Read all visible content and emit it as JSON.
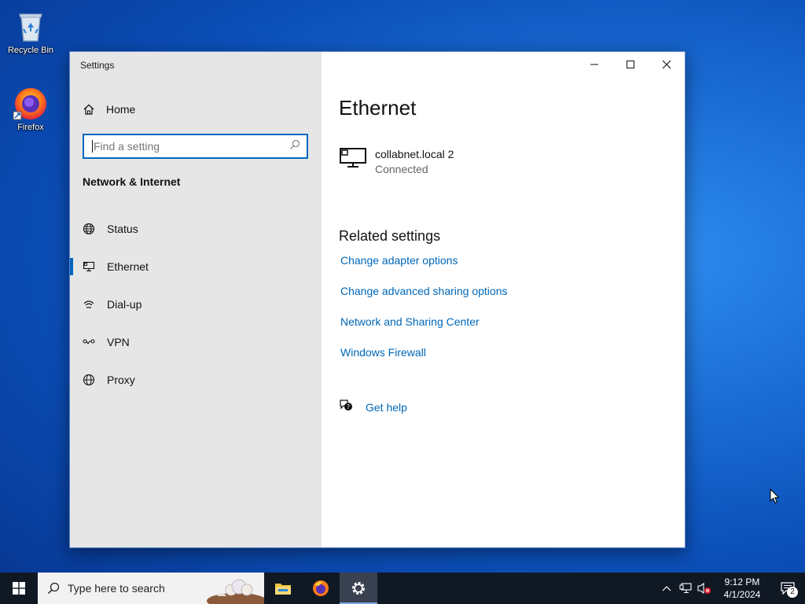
{
  "desktop": {
    "icons": [
      {
        "label": "Recycle Bin",
        "icon": "recycle-bin-icon"
      },
      {
        "label": "Firefox",
        "icon": "firefox-icon"
      }
    ]
  },
  "window": {
    "app_title": "Settings",
    "nav": {
      "home_label": "Home",
      "search_placeholder": "Find a setting",
      "section_title": "Network & Internet",
      "items": [
        {
          "label": "Status",
          "icon": "status-globe-icon"
        },
        {
          "label": "Ethernet",
          "icon": "ethernet-icon",
          "selected": true
        },
        {
          "label": "Dial-up",
          "icon": "dialup-icon"
        },
        {
          "label": "VPN",
          "icon": "vpn-icon"
        },
        {
          "label": "Proxy",
          "icon": "proxy-globe-icon"
        }
      ]
    },
    "content": {
      "page_title": "Ethernet",
      "connection": {
        "name": "collabnet.local 2",
        "status": "Connected"
      },
      "related_title": "Related settings",
      "links": [
        "Change adapter options",
        "Change advanced sharing options",
        "Network and Sharing Center",
        "Windows Firewall"
      ],
      "help_label": "Get help"
    }
  },
  "taskbar": {
    "search_placeholder": "Type here to search",
    "clock_time": "9:12 PM",
    "clock_date": "4/1/2024",
    "notification_count": "2"
  },
  "colors": {
    "accent": "#0067c0",
    "link": "#0067b8",
    "nav_bg": "#e6e6e6",
    "taskbar_bg": "#101824"
  }
}
